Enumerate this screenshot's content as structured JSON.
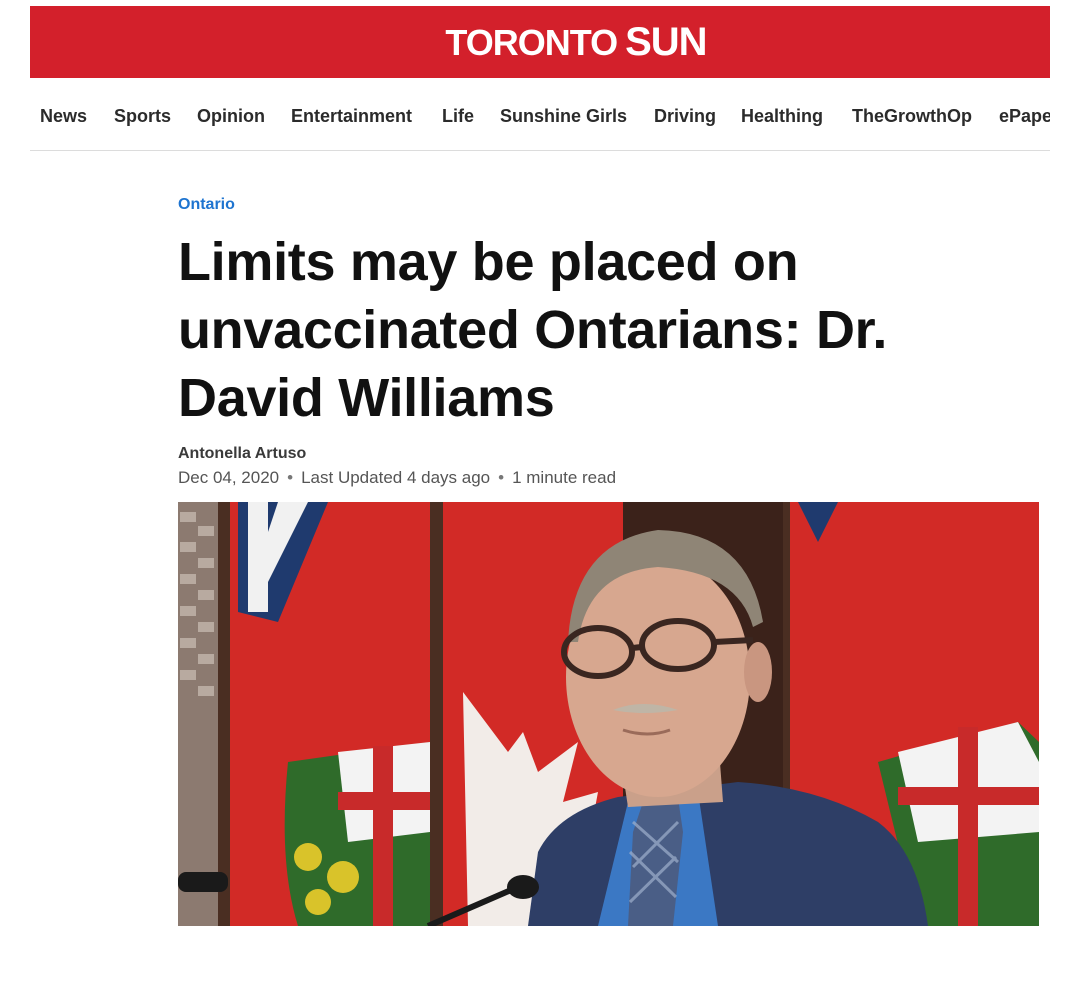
{
  "masthead": {
    "logo_part1": "TORONTO",
    "logo_part2": "SUN",
    "brand_color": "#d3202b"
  },
  "nav": {
    "items": [
      "News",
      "Sports",
      "Opinion",
      "Entertainment",
      "Life",
      "Sunshine Girls",
      "Driving",
      "Healthing",
      "TheGrowthOp",
      "ePaper"
    ]
  },
  "article": {
    "section": "Ontario",
    "section_color": "#1e74d0",
    "headline_line1": "Limits may be placed on",
    "headline_line2": "unvaccinated Ontarians: Dr.",
    "headline_line3": "David Williams",
    "author": "Antonella Artuso",
    "date": "Dec 04, 2020",
    "updated": "Last Updated 4 days ago",
    "read_time": "1 minute read"
  }
}
